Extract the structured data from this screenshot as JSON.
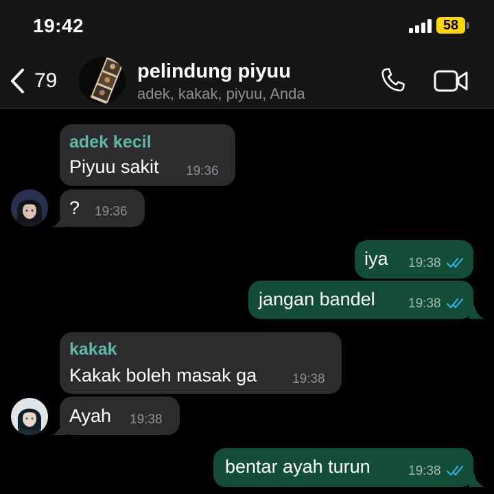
{
  "status_bar": {
    "time": "19:42",
    "battery": "58"
  },
  "header": {
    "back_count": "79",
    "group_name": "pelindung piyuu",
    "members": "adek, kakak, piyuu, Anda"
  },
  "colors": {
    "incoming_bubble": "#2c2c2e",
    "outgoing_bubble": "#134d37",
    "sender_name": "#62b7a8",
    "read_ticks": "#34b7f1",
    "battery": "#ffd60a"
  },
  "messages": [
    {
      "direction": "incoming",
      "sender": "adek kecil",
      "text": "Piyuu sakit",
      "time": "19:36"
    },
    {
      "direction": "incoming",
      "text": "?",
      "time": "19:36"
    },
    {
      "direction": "outgoing",
      "text": "iya",
      "time": "19:38",
      "status": "read"
    },
    {
      "direction": "outgoing",
      "text": "jangan bandel",
      "time": "19:38",
      "status": "read"
    },
    {
      "direction": "incoming",
      "sender": "kakak",
      "text": "Kakak boleh masak ga",
      "time": "19:38"
    },
    {
      "direction": "incoming",
      "text": "Ayah",
      "time": "19:38"
    },
    {
      "direction": "outgoing",
      "text": "bentar ayah turun",
      "time": "19:38",
      "status": "read"
    }
  ]
}
